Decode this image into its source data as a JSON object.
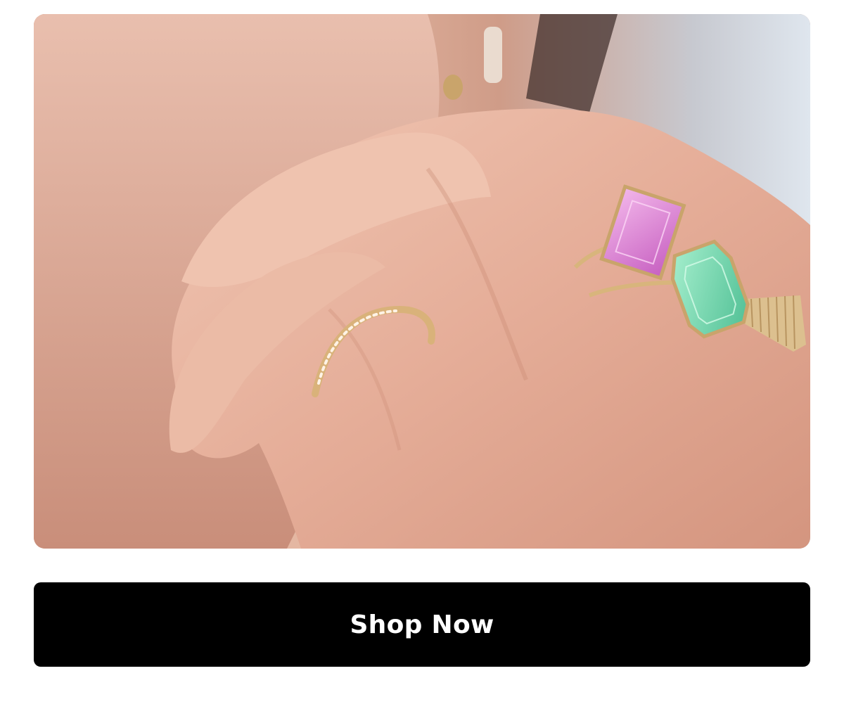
{
  "hero": {
    "image_subject": "hand-with-gemstone-rings-photo"
  },
  "cta": {
    "label": "Shop Now"
  },
  "colors": {
    "button_bg": "#000000",
    "button_text": "#ffffff",
    "page_bg": "#ffffff"
  }
}
